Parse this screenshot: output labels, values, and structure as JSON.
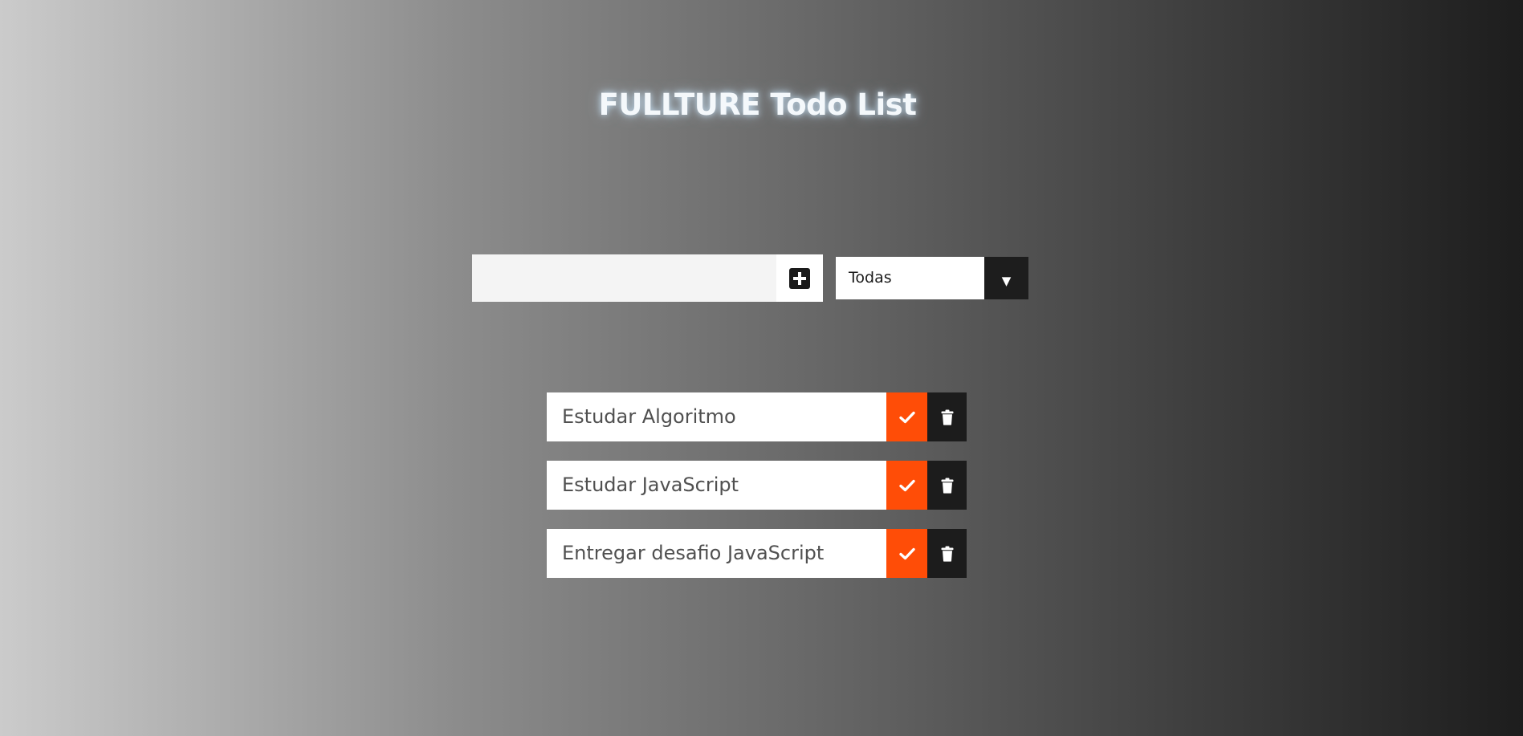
{
  "header": {
    "title": "FULLTURE Todo List"
  },
  "add_form": {
    "input_value": "",
    "add_button_icon": "plus-square-icon"
  },
  "filter": {
    "selected": "Todas",
    "arrow": "▼"
  },
  "todos": [
    {
      "text": "Estudar Algoritmo"
    },
    {
      "text": "Estudar JavaScript"
    },
    {
      "text": "Entregar desafio JavaScript"
    }
  ],
  "colors": {
    "accent": "#ff4d07",
    "dark": "#1c1c1c",
    "title_glow": "#c8e1f5"
  }
}
